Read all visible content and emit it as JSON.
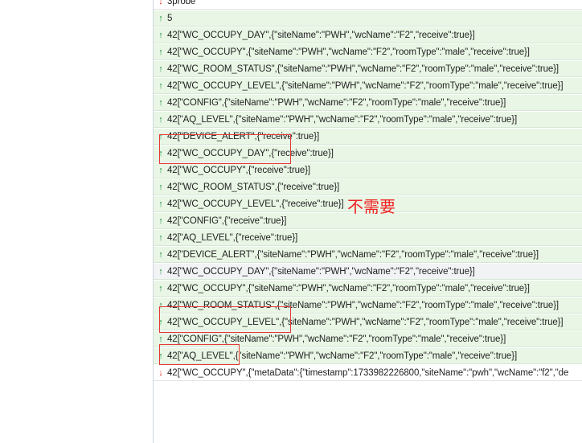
{
  "frames": [
    {
      "text": "3probe",
      "direction": "down"
    },
    {
      "text": "5",
      "direction": "up"
    },
    {
      "text": "42[\"WC_OCCUPY_DAY\",{\"siteName\":\"PWH\",\"wcName\":\"F2\",\"receive\":true}]",
      "direction": "up"
    },
    {
      "text": "42[\"WC_OCCUPY\",{\"siteName\":\"PWH\",\"wcName\":\"F2\",\"roomType\":\"male\",\"receive\":true}]",
      "direction": "up"
    },
    {
      "text": "42[\"WC_ROOM_STATUS\",{\"siteName\":\"PWH\",\"wcName\":\"F2\",\"roomType\":\"male\",\"receive\":true}]",
      "direction": "up"
    },
    {
      "text": "42[\"WC_OCCUPY_LEVEL\",{\"siteName\":\"PWH\",\"wcName\":\"F2\",\"roomType\":\"male\",\"receive\":true}]",
      "direction": "up"
    },
    {
      "text": "42[\"CONFIG\",{\"siteName\":\"PWH\",\"wcName\":\"F2\",\"roomType\":\"male\",\"receive\":true}]",
      "direction": "up"
    },
    {
      "text": "42[\"AQ_LEVEL\",{\"siteName\":\"PWH\",\"wcName\":\"F2\",\"roomType\":\"male\",\"receive\":true}]",
      "direction": "up"
    },
    {
      "text": "42[\"DEVICE_ALERT\",{\"receive\":true}]",
      "direction": "up"
    },
    {
      "text": "42[\"WC_OCCUPY_DAY\",{\"receive\":true}]",
      "direction": "up"
    },
    {
      "text": "42[\"WC_OCCUPY\",{\"receive\":true}]",
      "direction": "up"
    },
    {
      "text": "42[\"WC_ROOM_STATUS\",{\"receive\":true}]",
      "direction": "up"
    },
    {
      "text": "42[\"WC_OCCUPY_LEVEL\",{\"receive\":true}]",
      "direction": "up"
    },
    {
      "text": "42[\"CONFIG\",{\"receive\":true}]",
      "direction": "up"
    },
    {
      "text": "42[\"AQ_LEVEL\",{\"receive\":true}]",
      "direction": "up"
    },
    {
      "text": "42[\"DEVICE_ALERT\",{\"siteName\":\"PWH\",\"wcName\":\"F2\",\"roomType\":\"male\",\"receive\":true}]",
      "direction": "up"
    },
    {
      "text": "42[\"WC_OCCUPY_DAY\",{\"siteName\":\"PWH\",\"wcName\":\"F2\",\"receive\":true}]",
      "direction": "up",
      "selected": true
    },
    {
      "text": "42[\"WC_OCCUPY\",{\"siteName\":\"PWH\",\"wcName\":\"F2\",\"roomType\":\"male\",\"receive\":true}]",
      "direction": "up"
    },
    {
      "text": "42[\"WC_ROOM_STATUS\",{\"siteName\":\"PWH\",\"wcName\":\"F2\",\"roomType\":\"male\",\"receive\":true}]",
      "direction": "up"
    },
    {
      "text": "42[\"WC_OCCUPY_LEVEL\",{\"siteName\":\"PWH\",\"wcName\":\"F2\",\"roomType\":\"male\",\"receive\":true}]",
      "direction": "up"
    },
    {
      "text": "42[\"CONFIG\",{\"siteName\":\"PWH\",\"wcName\":\"F2\",\"roomType\":\"male\",\"receive\":true}]",
      "direction": "up"
    },
    {
      "text": "42[\"AQ_LEVEL\",{\"siteName\":\"PWH\",\"wcName\":\"F2\",\"roomType\":\"male\",\"receive\":true}]",
      "direction": "up"
    },
    {
      "text": "42[\"WC_OCCUPY\",{\"metaData\":{\"timestamp\":1733982226800,\"siteName\":\"pwh\",\"wcName\":\"f2\",\"de",
      "direction": "down"
    }
  ],
  "annotation": {
    "text": "不需要",
    "color": "#ee2222"
  },
  "colors": {
    "sent_bg": "#e9f6e5",
    "sent_arrow": "#1e8e3e",
    "received_arrow": "#d93025",
    "highlight_box": "#e53935"
  }
}
